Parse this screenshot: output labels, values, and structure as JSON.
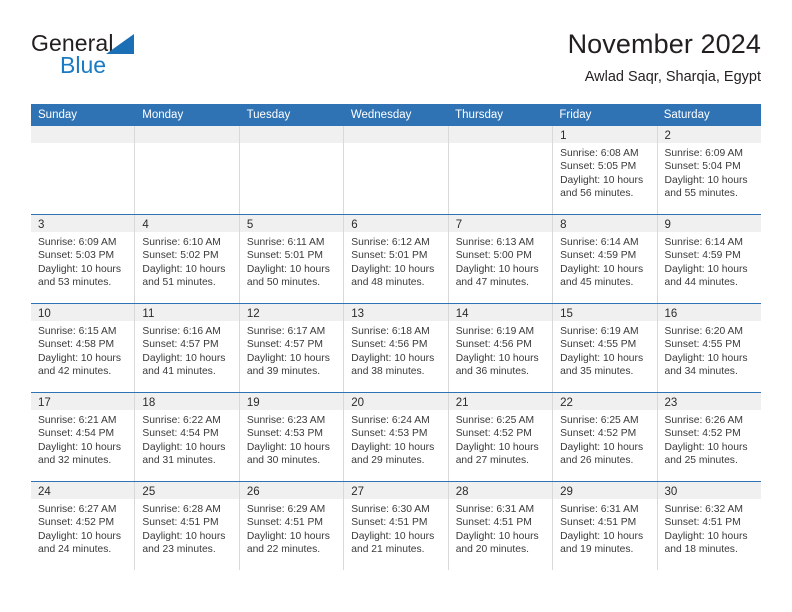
{
  "brand": {
    "name_part1": "General",
    "name_part2": "Blue"
  },
  "header": {
    "title": "November 2024",
    "subtitle": "Awlad Saqr, Sharqia, Egypt"
  },
  "colors": {
    "header_blue": "#3073b4",
    "brand_blue": "#1b7ac4",
    "day_band_gray": "#f0f0f0",
    "text": "#2b2b2b"
  },
  "weekdays": [
    "Sunday",
    "Monday",
    "Tuesday",
    "Wednesday",
    "Thursday",
    "Friday",
    "Saturday"
  ],
  "weeks": [
    [
      {
        "day": "",
        "empty": true
      },
      {
        "day": "",
        "empty": true
      },
      {
        "day": "",
        "empty": true
      },
      {
        "day": "",
        "empty": true
      },
      {
        "day": "",
        "empty": true
      },
      {
        "day": "1",
        "sunrise": "Sunrise: 6:08 AM",
        "sunset": "Sunset: 5:05 PM",
        "daylight1": "Daylight: 10 hours",
        "daylight2": "and 56 minutes."
      },
      {
        "day": "2",
        "sunrise": "Sunrise: 6:09 AM",
        "sunset": "Sunset: 5:04 PM",
        "daylight1": "Daylight: 10 hours",
        "daylight2": "and 55 minutes."
      }
    ],
    [
      {
        "day": "3",
        "sunrise": "Sunrise: 6:09 AM",
        "sunset": "Sunset: 5:03 PM",
        "daylight1": "Daylight: 10 hours",
        "daylight2": "and 53 minutes."
      },
      {
        "day": "4",
        "sunrise": "Sunrise: 6:10 AM",
        "sunset": "Sunset: 5:02 PM",
        "daylight1": "Daylight: 10 hours",
        "daylight2": "and 51 minutes."
      },
      {
        "day": "5",
        "sunrise": "Sunrise: 6:11 AM",
        "sunset": "Sunset: 5:01 PM",
        "daylight1": "Daylight: 10 hours",
        "daylight2": "and 50 minutes."
      },
      {
        "day": "6",
        "sunrise": "Sunrise: 6:12 AM",
        "sunset": "Sunset: 5:01 PM",
        "daylight1": "Daylight: 10 hours",
        "daylight2": "and 48 minutes."
      },
      {
        "day": "7",
        "sunrise": "Sunrise: 6:13 AM",
        "sunset": "Sunset: 5:00 PM",
        "daylight1": "Daylight: 10 hours",
        "daylight2": "and 47 minutes."
      },
      {
        "day": "8",
        "sunrise": "Sunrise: 6:14 AM",
        "sunset": "Sunset: 4:59 PM",
        "daylight1": "Daylight: 10 hours",
        "daylight2": "and 45 minutes."
      },
      {
        "day": "9",
        "sunrise": "Sunrise: 6:14 AM",
        "sunset": "Sunset: 4:59 PM",
        "daylight1": "Daylight: 10 hours",
        "daylight2": "and 44 minutes."
      }
    ],
    [
      {
        "day": "10",
        "sunrise": "Sunrise: 6:15 AM",
        "sunset": "Sunset: 4:58 PM",
        "daylight1": "Daylight: 10 hours",
        "daylight2": "and 42 minutes."
      },
      {
        "day": "11",
        "sunrise": "Sunrise: 6:16 AM",
        "sunset": "Sunset: 4:57 PM",
        "daylight1": "Daylight: 10 hours",
        "daylight2": "and 41 minutes."
      },
      {
        "day": "12",
        "sunrise": "Sunrise: 6:17 AM",
        "sunset": "Sunset: 4:57 PM",
        "daylight1": "Daylight: 10 hours",
        "daylight2": "and 39 minutes."
      },
      {
        "day": "13",
        "sunrise": "Sunrise: 6:18 AM",
        "sunset": "Sunset: 4:56 PM",
        "daylight1": "Daylight: 10 hours",
        "daylight2": "and 38 minutes."
      },
      {
        "day": "14",
        "sunrise": "Sunrise: 6:19 AM",
        "sunset": "Sunset: 4:56 PM",
        "daylight1": "Daylight: 10 hours",
        "daylight2": "and 36 minutes."
      },
      {
        "day": "15",
        "sunrise": "Sunrise: 6:19 AM",
        "sunset": "Sunset: 4:55 PM",
        "daylight1": "Daylight: 10 hours",
        "daylight2": "and 35 minutes."
      },
      {
        "day": "16",
        "sunrise": "Sunrise: 6:20 AM",
        "sunset": "Sunset: 4:55 PM",
        "daylight1": "Daylight: 10 hours",
        "daylight2": "and 34 minutes."
      }
    ],
    [
      {
        "day": "17",
        "sunrise": "Sunrise: 6:21 AM",
        "sunset": "Sunset: 4:54 PM",
        "daylight1": "Daylight: 10 hours",
        "daylight2": "and 32 minutes."
      },
      {
        "day": "18",
        "sunrise": "Sunrise: 6:22 AM",
        "sunset": "Sunset: 4:54 PM",
        "daylight1": "Daylight: 10 hours",
        "daylight2": "and 31 minutes."
      },
      {
        "day": "19",
        "sunrise": "Sunrise: 6:23 AM",
        "sunset": "Sunset: 4:53 PM",
        "daylight1": "Daylight: 10 hours",
        "daylight2": "and 30 minutes."
      },
      {
        "day": "20",
        "sunrise": "Sunrise: 6:24 AM",
        "sunset": "Sunset: 4:53 PM",
        "daylight1": "Daylight: 10 hours",
        "daylight2": "and 29 minutes."
      },
      {
        "day": "21",
        "sunrise": "Sunrise: 6:25 AM",
        "sunset": "Sunset: 4:52 PM",
        "daylight1": "Daylight: 10 hours",
        "daylight2": "and 27 minutes."
      },
      {
        "day": "22",
        "sunrise": "Sunrise: 6:25 AM",
        "sunset": "Sunset: 4:52 PM",
        "daylight1": "Daylight: 10 hours",
        "daylight2": "and 26 minutes."
      },
      {
        "day": "23",
        "sunrise": "Sunrise: 6:26 AM",
        "sunset": "Sunset: 4:52 PM",
        "daylight1": "Daylight: 10 hours",
        "daylight2": "and 25 minutes."
      }
    ],
    [
      {
        "day": "24",
        "sunrise": "Sunrise: 6:27 AM",
        "sunset": "Sunset: 4:52 PM",
        "daylight1": "Daylight: 10 hours",
        "daylight2": "and 24 minutes."
      },
      {
        "day": "25",
        "sunrise": "Sunrise: 6:28 AM",
        "sunset": "Sunset: 4:51 PM",
        "daylight1": "Daylight: 10 hours",
        "daylight2": "and 23 minutes."
      },
      {
        "day": "26",
        "sunrise": "Sunrise: 6:29 AM",
        "sunset": "Sunset: 4:51 PM",
        "daylight1": "Daylight: 10 hours",
        "daylight2": "and 22 minutes."
      },
      {
        "day": "27",
        "sunrise": "Sunrise: 6:30 AM",
        "sunset": "Sunset: 4:51 PM",
        "daylight1": "Daylight: 10 hours",
        "daylight2": "and 21 minutes."
      },
      {
        "day": "28",
        "sunrise": "Sunrise: 6:31 AM",
        "sunset": "Sunset: 4:51 PM",
        "daylight1": "Daylight: 10 hours",
        "daylight2": "and 20 minutes."
      },
      {
        "day": "29",
        "sunrise": "Sunrise: 6:31 AM",
        "sunset": "Sunset: 4:51 PM",
        "daylight1": "Daylight: 10 hours",
        "daylight2": "and 19 minutes."
      },
      {
        "day": "30",
        "sunrise": "Sunrise: 6:32 AM",
        "sunset": "Sunset: 4:51 PM",
        "daylight1": "Daylight: 10 hours",
        "daylight2": "and 18 minutes."
      }
    ]
  ]
}
